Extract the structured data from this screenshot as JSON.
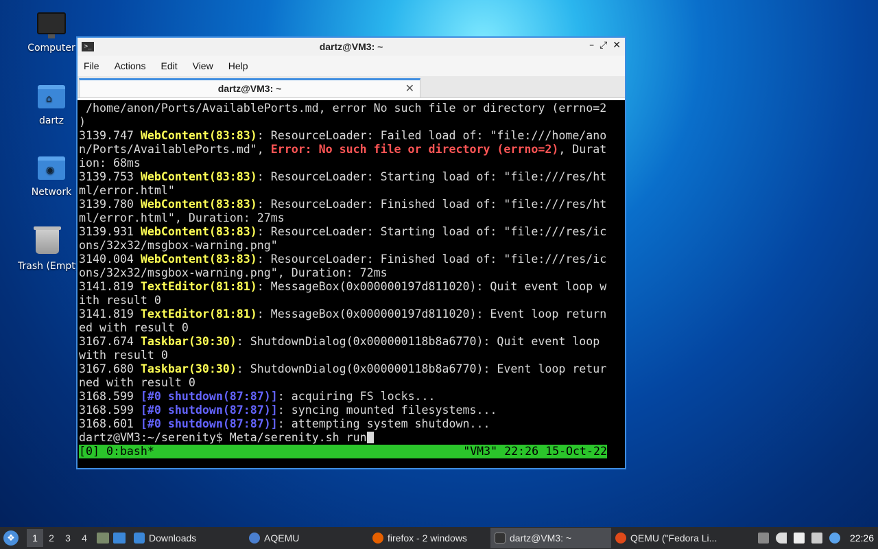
{
  "desktop": {
    "icons": [
      {
        "label": "Computer"
      },
      {
        "label": "dartz"
      },
      {
        "label": "Network"
      },
      {
        "label": "Trash (Empty)"
      }
    ]
  },
  "window": {
    "title": "dartz@VM3: ~",
    "controls": {
      "minimize": "–",
      "maximize": "⤢",
      "close": "✕"
    },
    "menu": [
      "File",
      "Actions",
      "Edit",
      "View",
      "Help"
    ],
    "tab": {
      "label": "dartz@VM3: ~",
      "close": "✕"
    }
  },
  "terminal": {
    "lines": [
      [
        {
          "t": " /home/anon/Ports/AvailablePorts.md, error No such file or directory (errno=2"
        }
      ],
      [
        {
          "t": ")"
        }
      ],
      [
        {
          "t": "3139.747 "
        },
        {
          "t": "WebContent(83:83)",
          "c": "y"
        },
        {
          "t": ": ResourceLoader: Failed load of: \"file:///home/ano"
        }
      ],
      [
        {
          "t": "n/Ports/AvailablePorts.md\", "
        },
        {
          "t": "Error: No such file or directory (errno=2)",
          "c": "r"
        },
        {
          "t": ", Durat"
        }
      ],
      [
        {
          "t": "ion: 68ms"
        }
      ],
      [
        {
          "t": "3139.753 "
        },
        {
          "t": "WebContent(83:83)",
          "c": "y"
        },
        {
          "t": ": ResourceLoader: Starting load of: \"file:///res/ht"
        }
      ],
      [
        {
          "t": "ml/error.html\""
        }
      ],
      [
        {
          "t": "3139.780 "
        },
        {
          "t": "WebContent(83:83)",
          "c": "y"
        },
        {
          "t": ": ResourceLoader: Finished load of: \"file:///res/ht"
        }
      ],
      [
        {
          "t": "ml/error.html\", Duration: 27ms"
        }
      ],
      [
        {
          "t": "3139.931 "
        },
        {
          "t": "WebContent(83:83)",
          "c": "y"
        },
        {
          "t": ": ResourceLoader: Starting load of: \"file:///res/ic"
        }
      ],
      [
        {
          "t": "ons/32x32/msgbox-warning.png\""
        }
      ],
      [
        {
          "t": "3140.004 "
        },
        {
          "t": "WebContent(83:83)",
          "c": "y"
        },
        {
          "t": ": ResourceLoader: Finished load of: \"file:///res/ic"
        }
      ],
      [
        {
          "t": "ons/32x32/msgbox-warning.png\", Duration: 72ms"
        }
      ],
      [
        {
          "t": "3141.819 "
        },
        {
          "t": "TextEditor(81:81)",
          "c": "y"
        },
        {
          "t": ": MessageBox(0x000000197d811020): Quit event loop w"
        }
      ],
      [
        {
          "t": "ith result 0"
        }
      ],
      [
        {
          "t": "3141.819 "
        },
        {
          "t": "TextEditor(81:81)",
          "c": "y"
        },
        {
          "t": ": MessageBox(0x000000197d811020): Event loop return"
        }
      ],
      [
        {
          "t": "ed with result 0"
        }
      ],
      [
        {
          "t": "3167.674 "
        },
        {
          "t": "Taskbar(30:30)",
          "c": "y"
        },
        {
          "t": ": ShutdownDialog(0x000000118b8a6770): Quit event loop"
        }
      ],
      [
        {
          "t": "with result 0"
        }
      ],
      [
        {
          "t": "3167.680 "
        },
        {
          "t": "Taskbar(30:30)",
          "c": "y"
        },
        {
          "t": ": ShutdownDialog(0x000000118b8a6770): Event loop retur"
        }
      ],
      [
        {
          "t": "ned with result 0"
        }
      ],
      [
        {
          "t": "3168.599 "
        },
        {
          "t": "[#0 ",
          "c": "b"
        },
        {
          "t": "shutdown(87:87)",
          "c": "b"
        },
        {
          "t": "]",
          "c": "b"
        },
        {
          "t": ": acquiring FS locks..."
        }
      ],
      [
        {
          "t": "3168.599 "
        },
        {
          "t": "[#0 ",
          "c": "b"
        },
        {
          "t": "shutdown(87:87)",
          "c": "b"
        },
        {
          "t": "]",
          "c": "b"
        },
        {
          "t": ": syncing mounted filesystems..."
        }
      ],
      [
        {
          "t": "3168.601 "
        },
        {
          "t": "[#0 ",
          "c": "b"
        },
        {
          "t": "shutdown(87:87)",
          "c": "b"
        },
        {
          "t": "]",
          "c": "b"
        },
        {
          "t": ": attempting system shutdown..."
        }
      ]
    ],
    "prompt": "dartz@VM3:~/serenity$ ",
    "command": "Meta/serenity.sh run",
    "status_left": "[0] 0:bash*",
    "status_right": "\"VM3\" 22:26 15-Oct-22"
  },
  "taskbar": {
    "workspaces": [
      "1",
      "2",
      "3",
      "4"
    ],
    "active_workspace": "1",
    "tasks": [
      {
        "label": "Downloads",
        "icon": "folder-icon",
        "color": "#3b87d8"
      },
      {
        "label": "AQEMU",
        "icon": "aqemu-icon",
        "color": "#4a7fd0"
      },
      {
        "label": "firefox - 2 windows",
        "icon": "firefox-icon",
        "color": "#e66000"
      },
      {
        "label": "dartz@VM3: ~",
        "icon": "terminal-icon",
        "color": "#333333",
        "active": true
      },
      {
        "label": "QEMU (\"Fedora Li...",
        "icon": "qemu-icon",
        "color": "#e04a1a"
      }
    ],
    "clock": "22:26"
  },
  "colors": {
    "accent": "#3f8de0",
    "status_bar": "#2bc52b",
    "highlight_yellow": "#ffff55",
    "error_red": "#ff5555",
    "kernel_blue": "#6464ff"
  }
}
